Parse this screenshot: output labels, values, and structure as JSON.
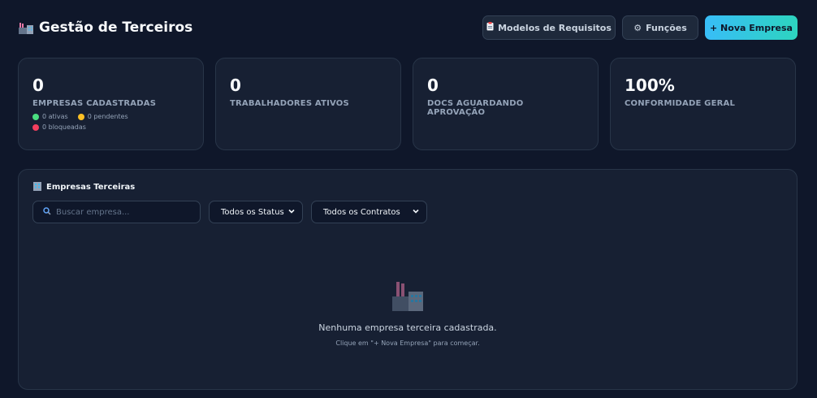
{
  "header": {
    "title": "Gestão de Terceiros",
    "title_icon": "factory-icon",
    "buttons": {
      "models": "Modelos de Requisitos",
      "models_icon": "clipboard-icon",
      "roles": "Funções",
      "roles_icon": "gear-icon",
      "new_company": "+ Nova Empresa"
    }
  },
  "stats": [
    {
      "value": "0",
      "label": "EMPRESAS CADASTRADAS"
    },
    {
      "value": "0",
      "label": "TRABALHADORES ATIVOS"
    },
    {
      "value": "0",
      "label": "DOCS AGUARDANDO APROVAÇÃO"
    },
    {
      "value": "100%",
      "label": "CONFORMIDADE GERAL"
    }
  ],
  "legend": {
    "active": "0 ativas",
    "pending": "0 pendentes",
    "blocked": "0 bloqueadas",
    "colors": {
      "active": "#4ade80",
      "pending": "#fbbf24",
      "blocked": "#f43f5e"
    }
  },
  "panel": {
    "title": "Empresas Terceiras",
    "title_icon": "office-building-icon",
    "search": {
      "placeholder": "Buscar empresa...",
      "value": ""
    },
    "status_filter": {
      "selected": "Todos os Status"
    },
    "contract_filter": {
      "selected": "Todos os Contratos"
    },
    "empty": {
      "icon": "factory-icon",
      "message": "Nenhuma empresa terceira cadastrada.",
      "hint": "Clique em \"+ Nova Empresa\" para começar."
    }
  },
  "colors": {
    "background": "#0f172a",
    "card": "#172033",
    "accent_start": "#38bdf8",
    "accent_end": "#2dd4bf"
  }
}
